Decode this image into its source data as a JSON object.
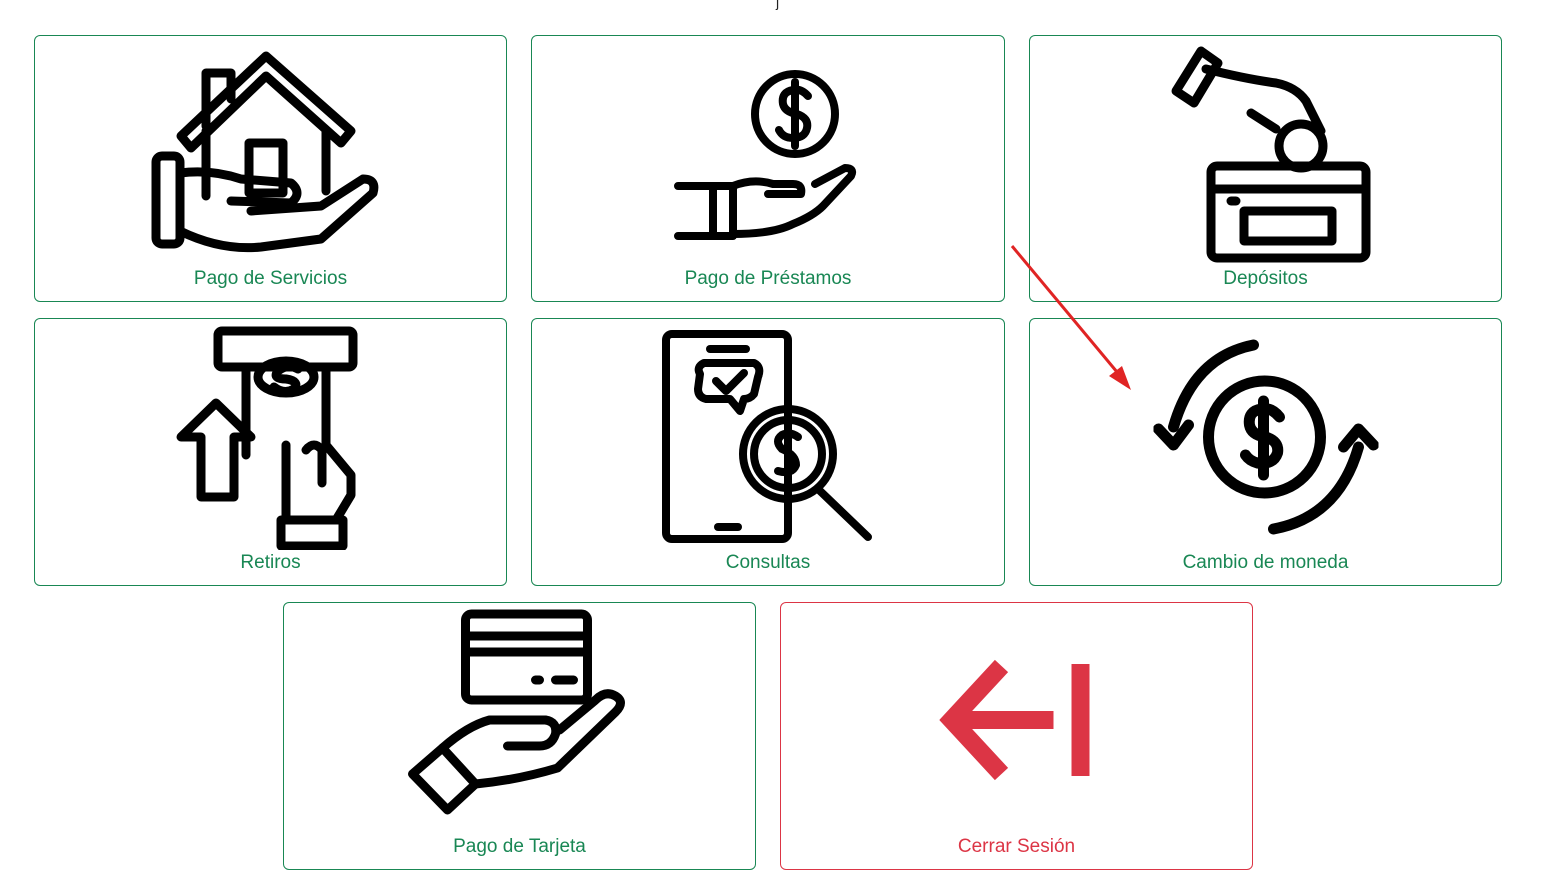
{
  "colors": {
    "success": "#198754",
    "danger": "#dc3545",
    "annotation": "#e02424",
    "icon": "#000000"
  },
  "menu": {
    "items": [
      {
        "id": "pago-servicios",
        "label": "Pago de Servicios",
        "icon": "house-in-hand-icon"
      },
      {
        "id": "pago-prestamos",
        "label": "Pago de Préstamos",
        "icon": "coin-in-hand-icon"
      },
      {
        "id": "depositos",
        "label": "Depósitos",
        "icon": "deposit-coin-box-icon"
      },
      {
        "id": "retiros",
        "label": "Retiros",
        "icon": "atm-withdraw-icon"
      },
      {
        "id": "consultas",
        "label": "Consultas",
        "icon": "phone-search-money-icon"
      },
      {
        "id": "cambio-moneda",
        "label": "Cambio de moneda",
        "icon": "currency-exchange-icon"
      },
      {
        "id": "pago-tarjeta",
        "label": "Pago de Tarjeta",
        "icon": "card-in-hand-icon"
      },
      {
        "id": "cerrar-sesion",
        "label": "Cerrar Sesión",
        "icon": "logout-arrow-icon"
      }
    ]
  }
}
